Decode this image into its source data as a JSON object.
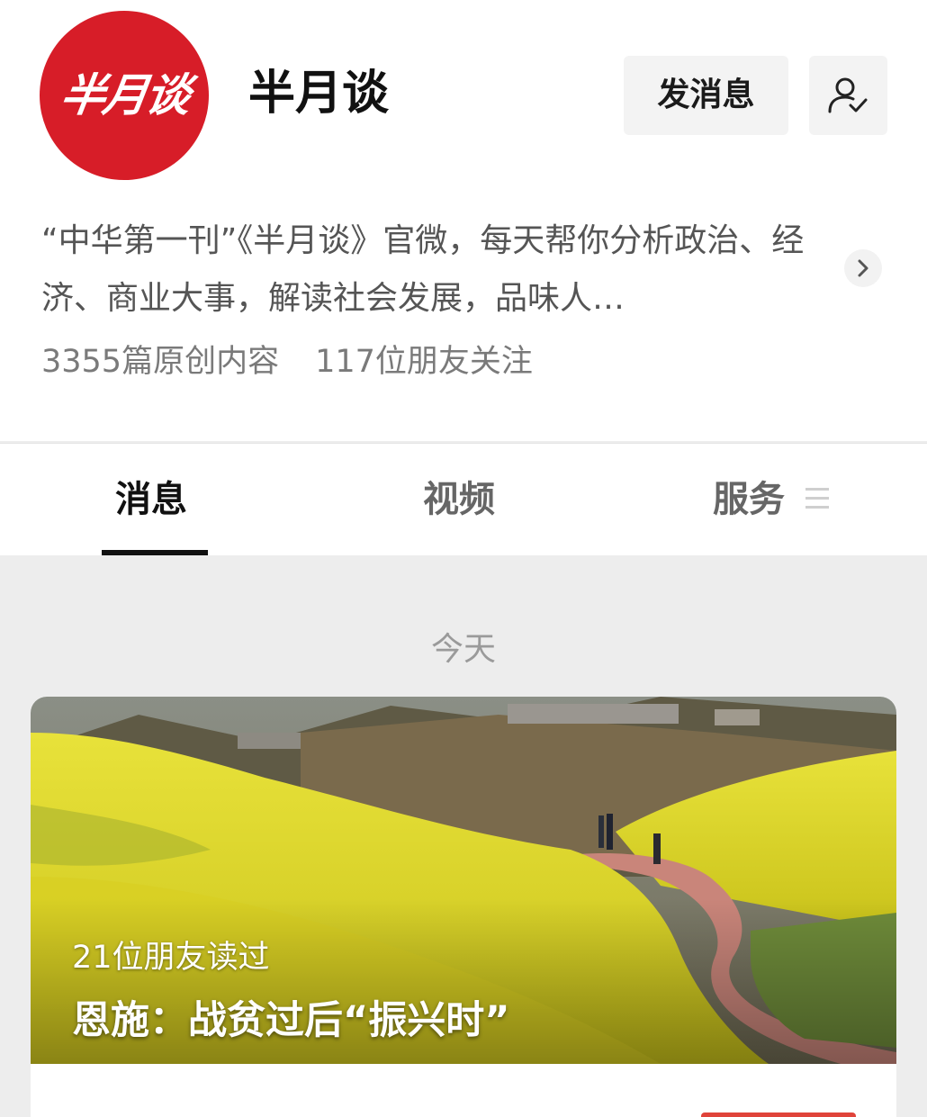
{
  "account": {
    "avatar_text": "半月谈",
    "name": "半月谈",
    "description": "“中华第一刊”《半月谈》官微，每天帮你分析政治、经济、商业大事，解读社会发展，品味人…",
    "original_count": "3355篇原创内容",
    "friends_following": "117位朋友关注"
  },
  "actions": {
    "message_label": "发消息",
    "follow_icon": "user-check-icon",
    "expand_icon": "chevron-right-icon"
  },
  "tabs": [
    {
      "label": "消息",
      "active": true
    },
    {
      "label": "视频",
      "active": false
    },
    {
      "label": "服务",
      "active": false
    }
  ],
  "tabs_menu_icon": "menu-lines-icon",
  "feed": {
    "date_label": "今天",
    "card": {
      "readers": "21位朋友读过",
      "title": "恩施：战贫过后“振兴时”"
    }
  },
  "colors": {
    "avatar_red": "#d71d28",
    "accent_red": "#e0433a",
    "page_background": "#ededed"
  }
}
